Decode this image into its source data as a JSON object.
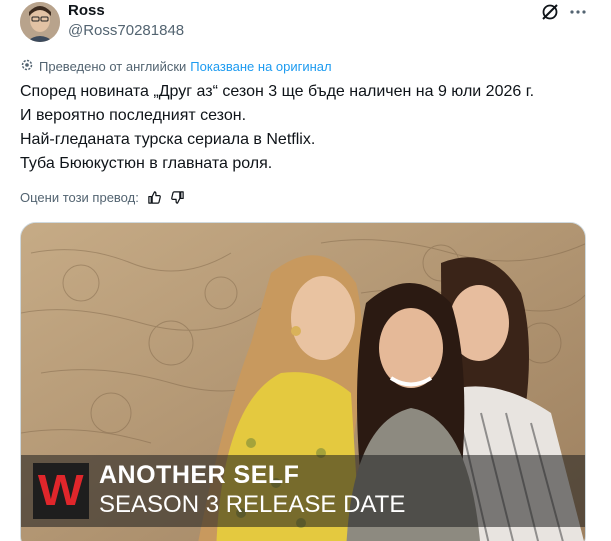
{
  "author": {
    "name": "Ross",
    "handle": "@Ross70281848"
  },
  "actions": {
    "grok_icon": "grok-slash-icon",
    "more_icon": "more-dots-icon"
  },
  "translation": {
    "translated_label": "Преведено от английски",
    "show_original_label": "Показване на оригинал"
  },
  "tweet": {
    "lines": [
      "Според новината „Друг аз“ сезон 3 ще бъде наличен на 9 юли 2026 г.",
      "И вероятно последният сезон.",
      "Най-гледаната турска сериала в Netflix.",
      "Туба Бююкустюн в главната роля."
    ]
  },
  "rate": {
    "label": "Оцени този превод:"
  },
  "media": {
    "logo_letter": "W",
    "title": "ANOTHER SELF",
    "subtitle": "SEASON 3 RELEASE DATE",
    "logo_color": "#e0262b"
  }
}
